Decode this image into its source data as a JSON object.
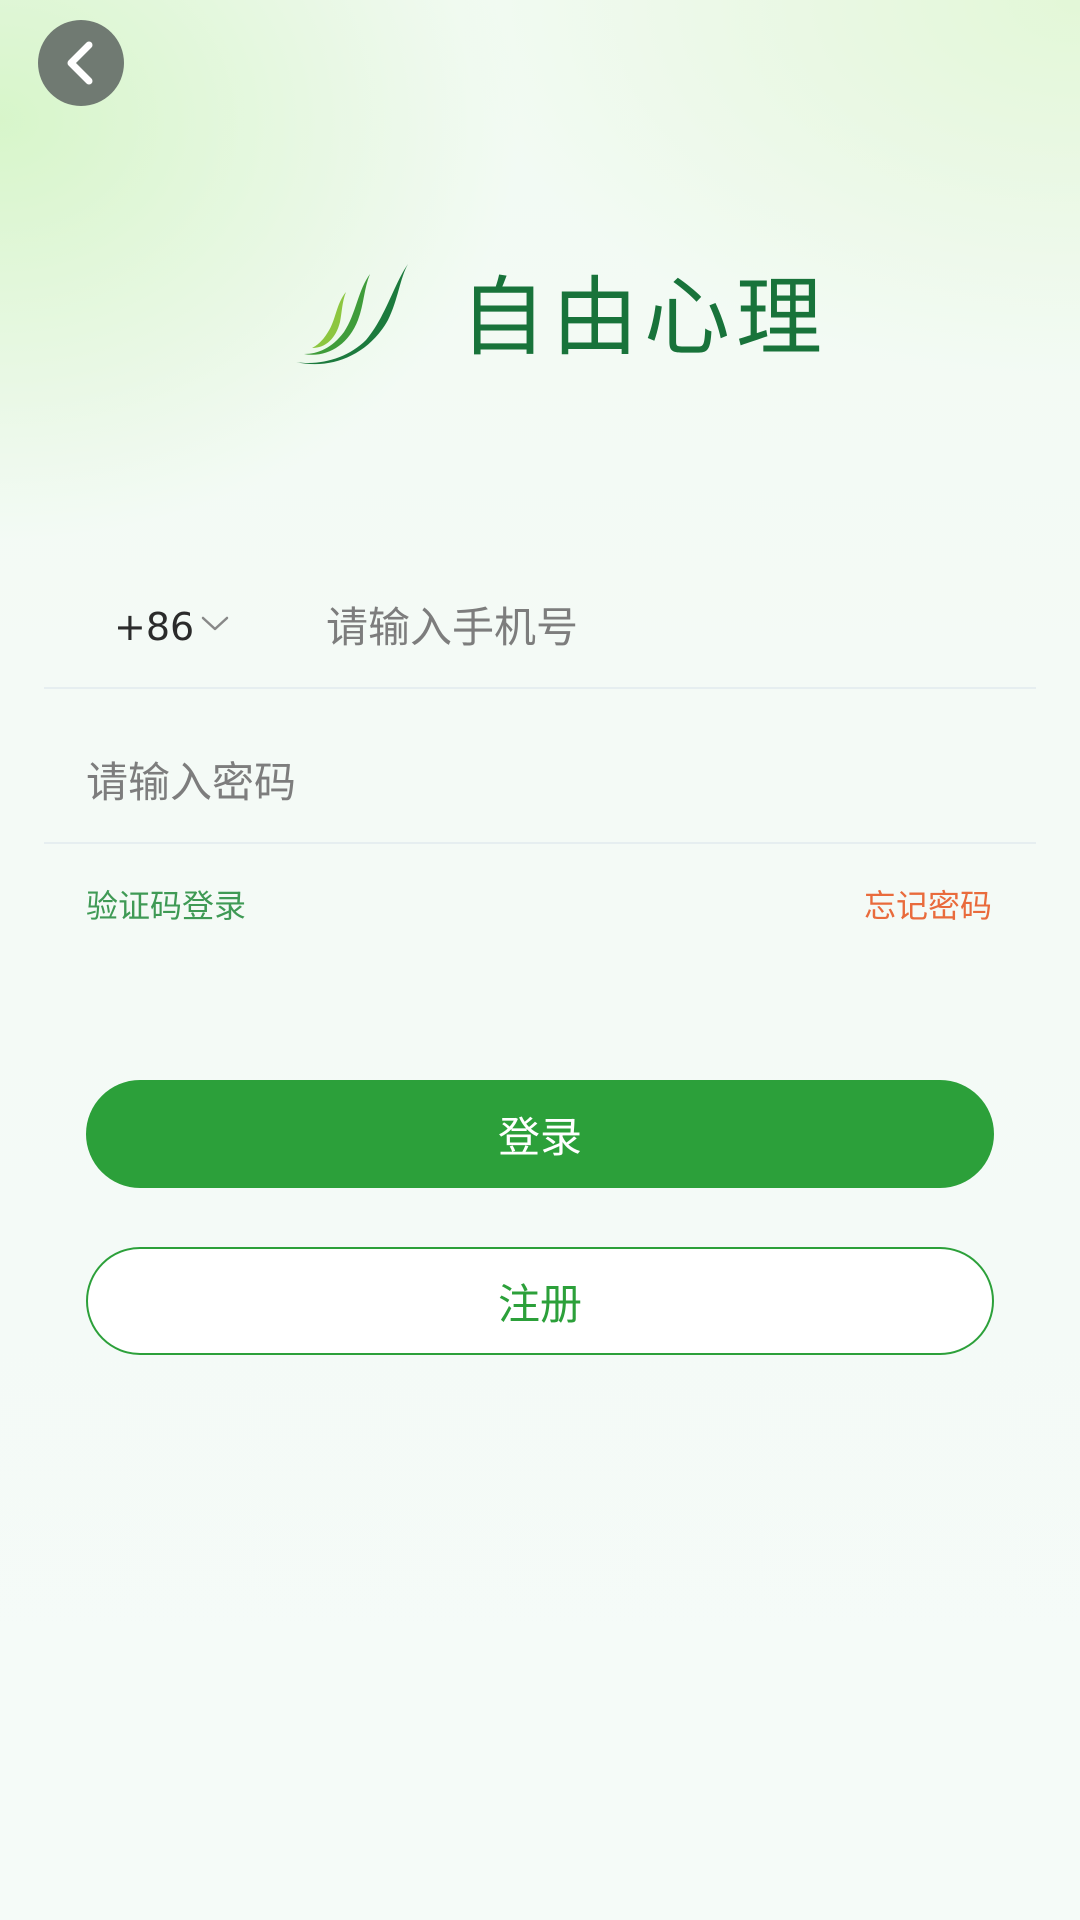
{
  "colors": {
    "brand_green": "#18733a",
    "primary_green": "#2ca03a",
    "link_green": "#3f9a55",
    "link_orange": "#e96b3c"
  },
  "header": {
    "back_icon": "chevron-left-icon"
  },
  "brand": {
    "logo_icon": "leaf-logo-icon",
    "name": "自由心理"
  },
  "login_form": {
    "country_code": "+86",
    "country_code_icon": "chevron-down-icon",
    "phone_placeholder": "请输入手机号",
    "password_placeholder": "请输入密码",
    "sms_login_label": "验证码登录",
    "forgot_password_label": "忘记密码",
    "login_label": "登录",
    "register_label": "注册"
  }
}
